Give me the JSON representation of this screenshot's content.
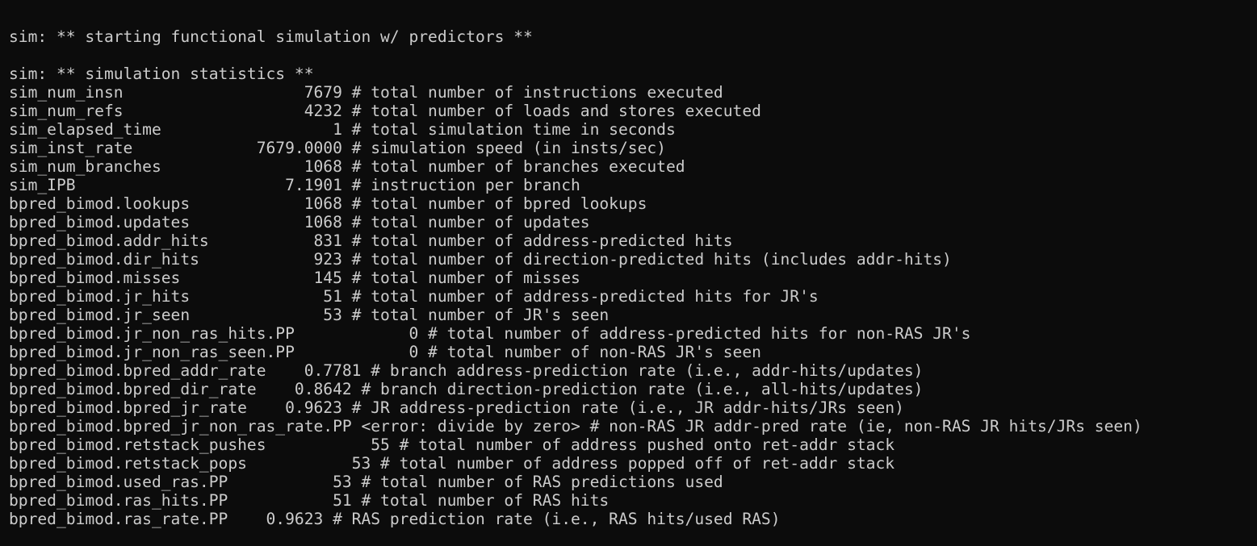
{
  "terminal": {
    "lines": [
      "sim: ** starting functional simulation w/ predictors **",
      "",
      "sim: ** simulation statistics **",
      "sim_num_insn                   7679 # total number of instructions executed",
      "sim_num_refs                   4232 # total number of loads and stores executed",
      "sim_elapsed_time                  1 # total simulation time in seconds",
      "sim_inst_rate             7679.0000 # simulation speed (in insts/sec)",
      "sim_num_branches               1068 # total number of branches executed",
      "sim_IPB                      7.1901 # instruction per branch",
      "bpred_bimod.lookups            1068 # total number of bpred lookups",
      "bpred_bimod.updates            1068 # total number of updates",
      "bpred_bimod.addr_hits           831 # total number of address-predicted hits",
      "bpred_bimod.dir_hits            923 # total number of direction-predicted hits (includes addr-hits)",
      "bpred_bimod.misses              145 # total number of misses",
      "bpred_bimod.jr_hits              51 # total number of address-predicted hits for JR's",
      "bpred_bimod.jr_seen              53 # total number of JR's seen",
      "bpred_bimod.jr_non_ras_hits.PP            0 # total number of address-predicted hits for non-RAS JR's",
      "bpred_bimod.jr_non_ras_seen.PP            0 # total number of non-RAS JR's seen",
      "bpred_bimod.bpred_addr_rate    0.7781 # branch address-prediction rate (i.e., addr-hits/updates)",
      "bpred_bimod.bpred_dir_rate    0.8642 # branch direction-prediction rate (i.e., all-hits/updates)",
      "bpred_bimod.bpred_jr_rate    0.9623 # JR address-prediction rate (i.e., JR addr-hits/JRs seen)",
      "bpred_bimod.bpred_jr_non_ras_rate.PP <error: divide by zero> # non-RAS JR addr-pred rate (ie, non-RAS JR hits/JRs seen)",
      "bpred_bimod.retstack_pushes           55 # total number of address pushed onto ret-addr stack",
      "bpred_bimod.retstack_pops           53 # total number of address popped off of ret-addr stack",
      "bpred_bimod.used_ras.PP           53 # total number of RAS predictions used",
      "bpred_bimod.ras_hits.PP           51 # total number of RAS hits",
      "bpred_bimod.ras_rate.PP    0.9623 # RAS prediction rate (i.e., RAS hits/used RAS)"
    ]
  }
}
